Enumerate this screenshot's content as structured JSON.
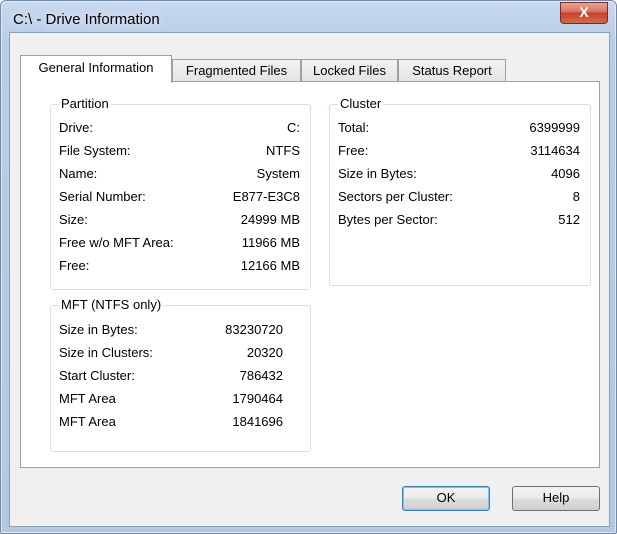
{
  "window": {
    "title": "C:\\ - Drive Information",
    "close_label": "X"
  },
  "tabs": [
    {
      "label": "General Information"
    },
    {
      "label": "Fragmented Files"
    },
    {
      "label": "Locked Files"
    },
    {
      "label": "Status Report"
    }
  ],
  "partition": {
    "title": "Partition",
    "rows": [
      {
        "label": "Drive:",
        "value": "C:"
      },
      {
        "label": "File System:",
        "value": "NTFS"
      },
      {
        "label": "Name:",
        "value": "System"
      },
      {
        "label": "Serial Number:",
        "value": "E877-E3C8"
      },
      {
        "label": "Size:",
        "value": "24999 MB"
      },
      {
        "label": "Free w/o MFT Area:",
        "value": "11966 MB"
      },
      {
        "label": "Free:",
        "value": "12166 MB"
      }
    ]
  },
  "cluster": {
    "title": "Cluster",
    "rows": [
      {
        "label": "Total:",
        "value": "6399999"
      },
      {
        "label": "Free:",
        "value": "3114634"
      },
      {
        "label": "Size in Bytes:",
        "value": "4096"
      },
      {
        "label": "Sectors per Cluster:",
        "value": "8"
      },
      {
        "label": "Bytes per Sector:",
        "value": "512"
      }
    ]
  },
  "mft": {
    "title": "MFT (NTFS only)",
    "rows": [
      {
        "label": "Size in Bytes:",
        "value": "83230720"
      },
      {
        "label": "Size in Clusters:",
        "value": "20320"
      },
      {
        "label": "Start Cluster:",
        "value": "786432"
      },
      {
        "label": "MFT Area",
        "value": "1790464"
      },
      {
        "label": "MFT Area",
        "value": "1841696"
      }
    ]
  },
  "buttons": {
    "ok": "OK",
    "help": "Help"
  }
}
